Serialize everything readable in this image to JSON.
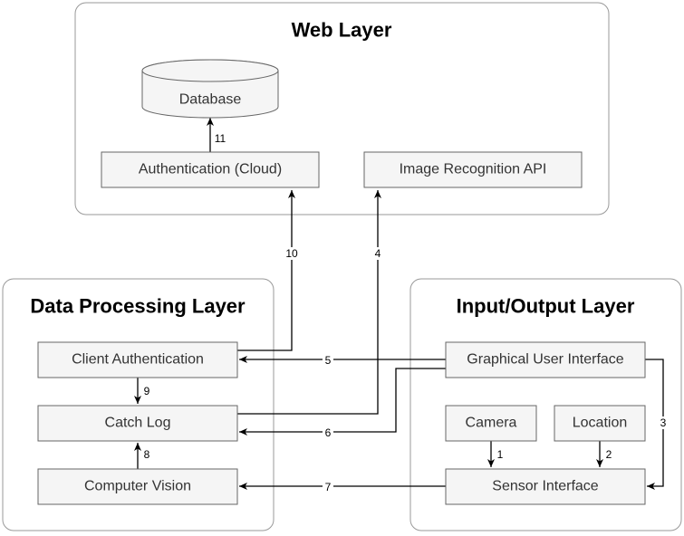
{
  "layers": {
    "web": "Web Layer",
    "data_processing": "Data Processing Layer",
    "io": "Input/Output Layer"
  },
  "nodes": {
    "database": "Database",
    "auth_cloud": "Authentication (Cloud)",
    "image_api": "Image Recognition API",
    "client_auth": "Client Authentication",
    "catch_log": "Catch Log",
    "computer_vision": "Computer Vision",
    "gui": "Graphical User Interface",
    "camera": "Camera",
    "location": "Location",
    "sensor": "Sensor Interface"
  },
  "edges": {
    "e1": "1",
    "e2": "2",
    "e3": "3",
    "e4": "4",
    "e5": "5",
    "e6": "6",
    "e7": "7",
    "e8": "8",
    "e9": "9",
    "e10": "10",
    "e11": "11"
  }
}
